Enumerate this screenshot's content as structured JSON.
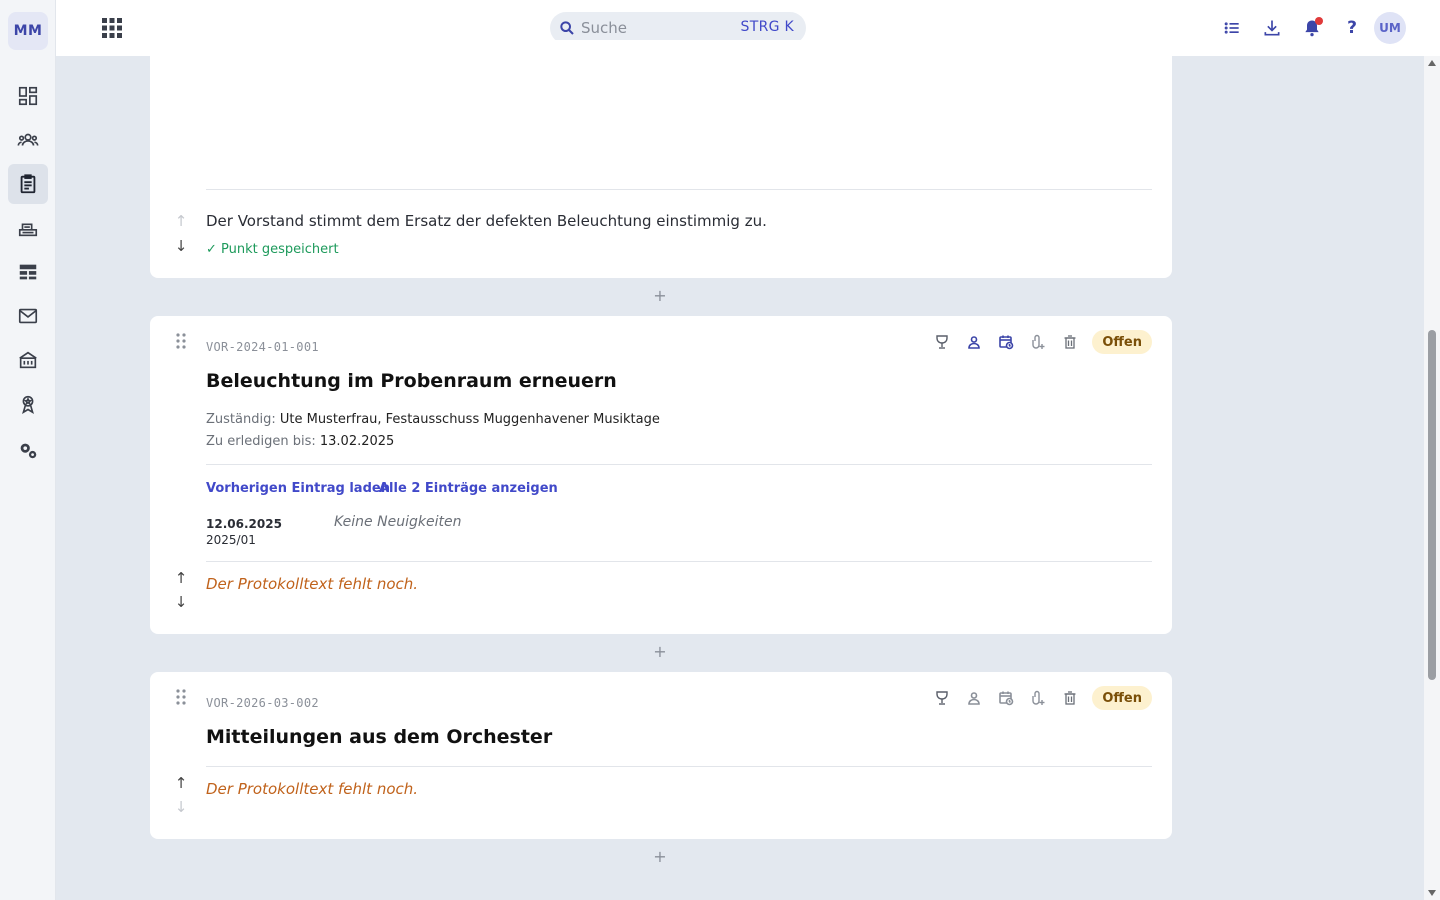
{
  "app": {
    "logo": "MM",
    "user_initials": "UM"
  },
  "search": {
    "placeholder": "Suche",
    "shortcut": "STRG K"
  },
  "sidebar": {
    "items": [
      {
        "icon": "dashboard-icon"
      },
      {
        "icon": "members-icon"
      },
      {
        "icon": "protocol-icon",
        "active": true
      },
      {
        "icon": "inventory-icon"
      },
      {
        "icon": "table-icon"
      },
      {
        "icon": "mail-icon"
      },
      {
        "icon": "building-icon"
      },
      {
        "icon": "award-icon"
      },
      {
        "icon": "settings-icon"
      }
    ]
  },
  "topbar": {
    "icons": [
      "list-icon",
      "download-icon",
      "bell-icon",
      "help-icon"
    ],
    "help_label": "?"
  },
  "card0": {
    "text": "Der Vorstand stimmt dem Ersatz der defekten Beleuchtung einstimmig zu.",
    "saved": "✓ Punkt gespeichert"
  },
  "add_label": "+",
  "card1": {
    "code": "VOR-2024-01-001",
    "title": "Beleuchtung im Probenraum erneuern",
    "responsible_label": "Zuständig:",
    "responsible": "Ute Musterfrau, Festausschuss Muggenhavener Musiktage",
    "due_label": "Zu erledigen bis:",
    "due": "13.02.2025",
    "status": "Offen",
    "link_prev": "Vorherigen Eintrag laden",
    "link_all": "Alle 2 Einträge anzeigen",
    "entry_date": "12.06.2025",
    "entry_ref": "2025/01",
    "entry_text": "Keine Neuigkeiten",
    "protocol_missing": "Der Protokolltext fehlt noch."
  },
  "card2": {
    "code": "VOR-2026-03-002",
    "title": "Mitteilungen aus dem Orchester",
    "status": "Offen",
    "protocol_missing": "Der Protokolltext fehlt noch."
  },
  "colors": {
    "accent": "#4149c9",
    "status_bg": "#fdf1cf",
    "status_text": "#7a4f08",
    "missing_text": "#c0621b",
    "saved_text": "#1d9a5b"
  }
}
